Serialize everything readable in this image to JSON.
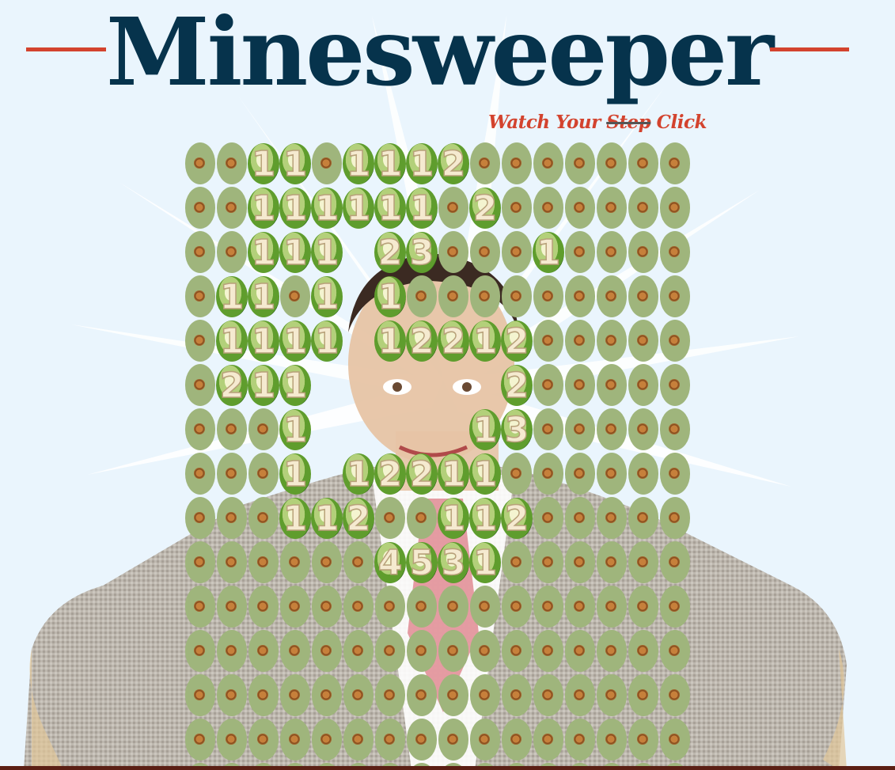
{
  "app": {
    "title": "Minesweeper",
    "tagline_prefix": "Watch Your ",
    "tagline_struck": "Step",
    "tagline_suffix": " Click"
  },
  "colors": {
    "title": "#06334c",
    "accent": "#d3432e",
    "covered_tile": "#9fb57c",
    "revealed_tile": "#5f9d2d",
    "number": "#f5ead0",
    "background": "#eaf5fd"
  },
  "board": {
    "columns": 16,
    "rows": [
      [
        "C",
        "C",
        "1",
        "1",
        "C",
        "1",
        "1",
        "1",
        "2",
        "C",
        "C",
        "C",
        "C",
        "C",
        "C",
        "C"
      ],
      [
        "C",
        "C",
        "1",
        "1",
        "1",
        "1",
        "1",
        "1",
        "C",
        "2",
        "C",
        "C",
        "C",
        "C",
        "C",
        "C"
      ],
      [
        "C",
        "C",
        "1",
        "1",
        "1",
        "",
        "2",
        "3",
        "C",
        "C",
        "C",
        "1",
        "C",
        "C",
        "C",
        "C"
      ],
      [
        "C",
        "1",
        "1",
        "C",
        "1",
        "",
        "1",
        "C",
        "C",
        "C",
        "C",
        "C",
        "C",
        "C",
        "C",
        "C"
      ],
      [
        "C",
        "1",
        "1",
        "1",
        "1",
        "",
        "1",
        "2",
        "2",
        "1",
        "2",
        "C",
        "C",
        "C",
        "C",
        "C"
      ],
      [
        "C",
        "2",
        "1",
        "1",
        "",
        "",
        "",
        "",
        "",
        "",
        "2",
        "C",
        "C",
        "C",
        "C",
        "C"
      ],
      [
        "C",
        "C",
        "C",
        "1",
        "",
        "",
        "",
        "",
        "",
        "1",
        "3",
        "C",
        "C",
        "C",
        "C",
        "C"
      ],
      [
        "C",
        "C",
        "C",
        "1",
        "",
        "1",
        "2",
        "2",
        "1",
        "1",
        "C",
        "C",
        "C",
        "C",
        "C",
        "C"
      ],
      [
        "C",
        "C",
        "C",
        "1",
        "1",
        "2",
        "C",
        "C",
        "1",
        "1",
        "2",
        "C",
        "C",
        "C",
        "C",
        "C"
      ],
      [
        "C",
        "C",
        "C",
        "C",
        "C",
        "C",
        "4",
        "5",
        "3",
        "1",
        "C",
        "C",
        "C",
        "C",
        "C",
        "C"
      ],
      [
        "C",
        "C",
        "C",
        "C",
        "C",
        "C",
        "C",
        "C",
        "C",
        "C",
        "C",
        "C",
        "C",
        "C",
        "C",
        "C"
      ],
      [
        "C",
        "C",
        "C",
        "C",
        "C",
        "C",
        "C",
        "C",
        "C",
        "C",
        "C",
        "C",
        "C",
        "C",
        "C",
        "C"
      ],
      [
        "C",
        "C",
        "C",
        "C",
        "C",
        "C",
        "C",
        "C",
        "C",
        "C",
        "C",
        "C",
        "C",
        "C",
        "C",
        "C"
      ],
      [
        "C",
        "C",
        "C",
        "C",
        "C",
        "C",
        "C",
        "C",
        "C",
        "C",
        "C",
        "C",
        "C",
        "C",
        "C",
        "C"
      ],
      [
        "C",
        "C",
        "C",
        "C",
        "C",
        "C",
        "C",
        "C",
        "C",
        "C",
        "C",
        "C",
        "C",
        "C",
        "C",
        "C"
      ]
    ]
  }
}
